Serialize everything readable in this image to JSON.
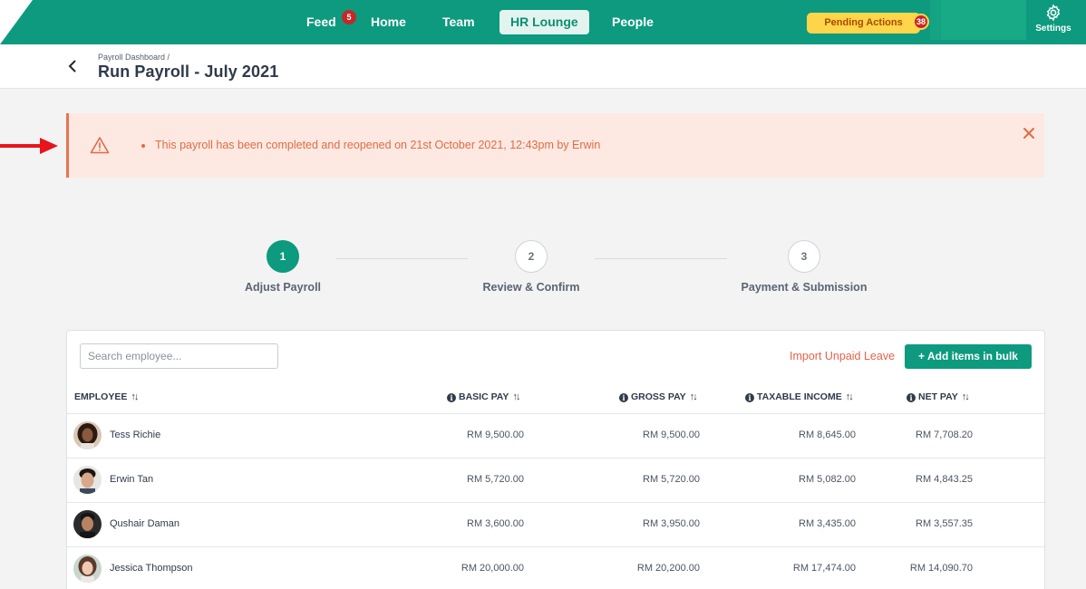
{
  "nav": {
    "items": [
      {
        "label": "Feed",
        "badge": "5"
      },
      {
        "label": "Home"
      },
      {
        "label": "Team"
      },
      {
        "label": "HR Lounge",
        "active": true
      },
      {
        "label": "People"
      }
    ],
    "pending_actions": {
      "label": "Pending Actions",
      "badge": "38"
    },
    "settings_label": "Settings",
    "brand_color": "#0d9a7e"
  },
  "header": {
    "breadcrumb": "Payroll Dashboard /",
    "title": "Run Payroll - July 2021"
  },
  "alert": {
    "message": "This payroll has been completed and reopened on 21st October 2021, 12:43pm by Erwin",
    "color": "#e06c45"
  },
  "stepper": {
    "steps": [
      {
        "number": "1",
        "label": "Adjust Payroll",
        "active": true
      },
      {
        "number": "2",
        "label": "Review & Confirm"
      },
      {
        "number": "3",
        "label": "Payment & Submission"
      }
    ]
  },
  "table": {
    "search_placeholder": "Search employee...",
    "import_label": "Import Unpaid Leave",
    "add_bulk_label": "+ Add items in bulk",
    "columns": {
      "employee": "EMPLOYEE",
      "basic_pay": "BASIC PAY",
      "gross_pay": "GROSS PAY",
      "taxable_income": "TAXABLE INCOME",
      "net_pay": "NET PAY"
    },
    "rows": [
      {
        "name": "Tess Richie",
        "basic_pay": "RM 9,500.00",
        "gross_pay": "RM 9,500.00",
        "taxable_income": "RM 8,645.00",
        "net_pay": "RM 7,708.20"
      },
      {
        "name": "Erwin Tan",
        "basic_pay": "RM 5,720.00",
        "gross_pay": "RM 5,720.00",
        "taxable_income": "RM 5,082.00",
        "net_pay": "RM 4,843.25"
      },
      {
        "name": "Qushair Daman",
        "basic_pay": "RM 3,600.00",
        "gross_pay": "RM 3,950.00",
        "taxable_income": "RM 3,435.00",
        "net_pay": "RM 3,557.35"
      },
      {
        "name": "Jessica Thompson",
        "basic_pay": "RM 20,000.00",
        "gross_pay": "RM 20,200.00",
        "taxable_income": "RM 17,474.00",
        "net_pay": "RM 14,090.70"
      }
    ]
  }
}
